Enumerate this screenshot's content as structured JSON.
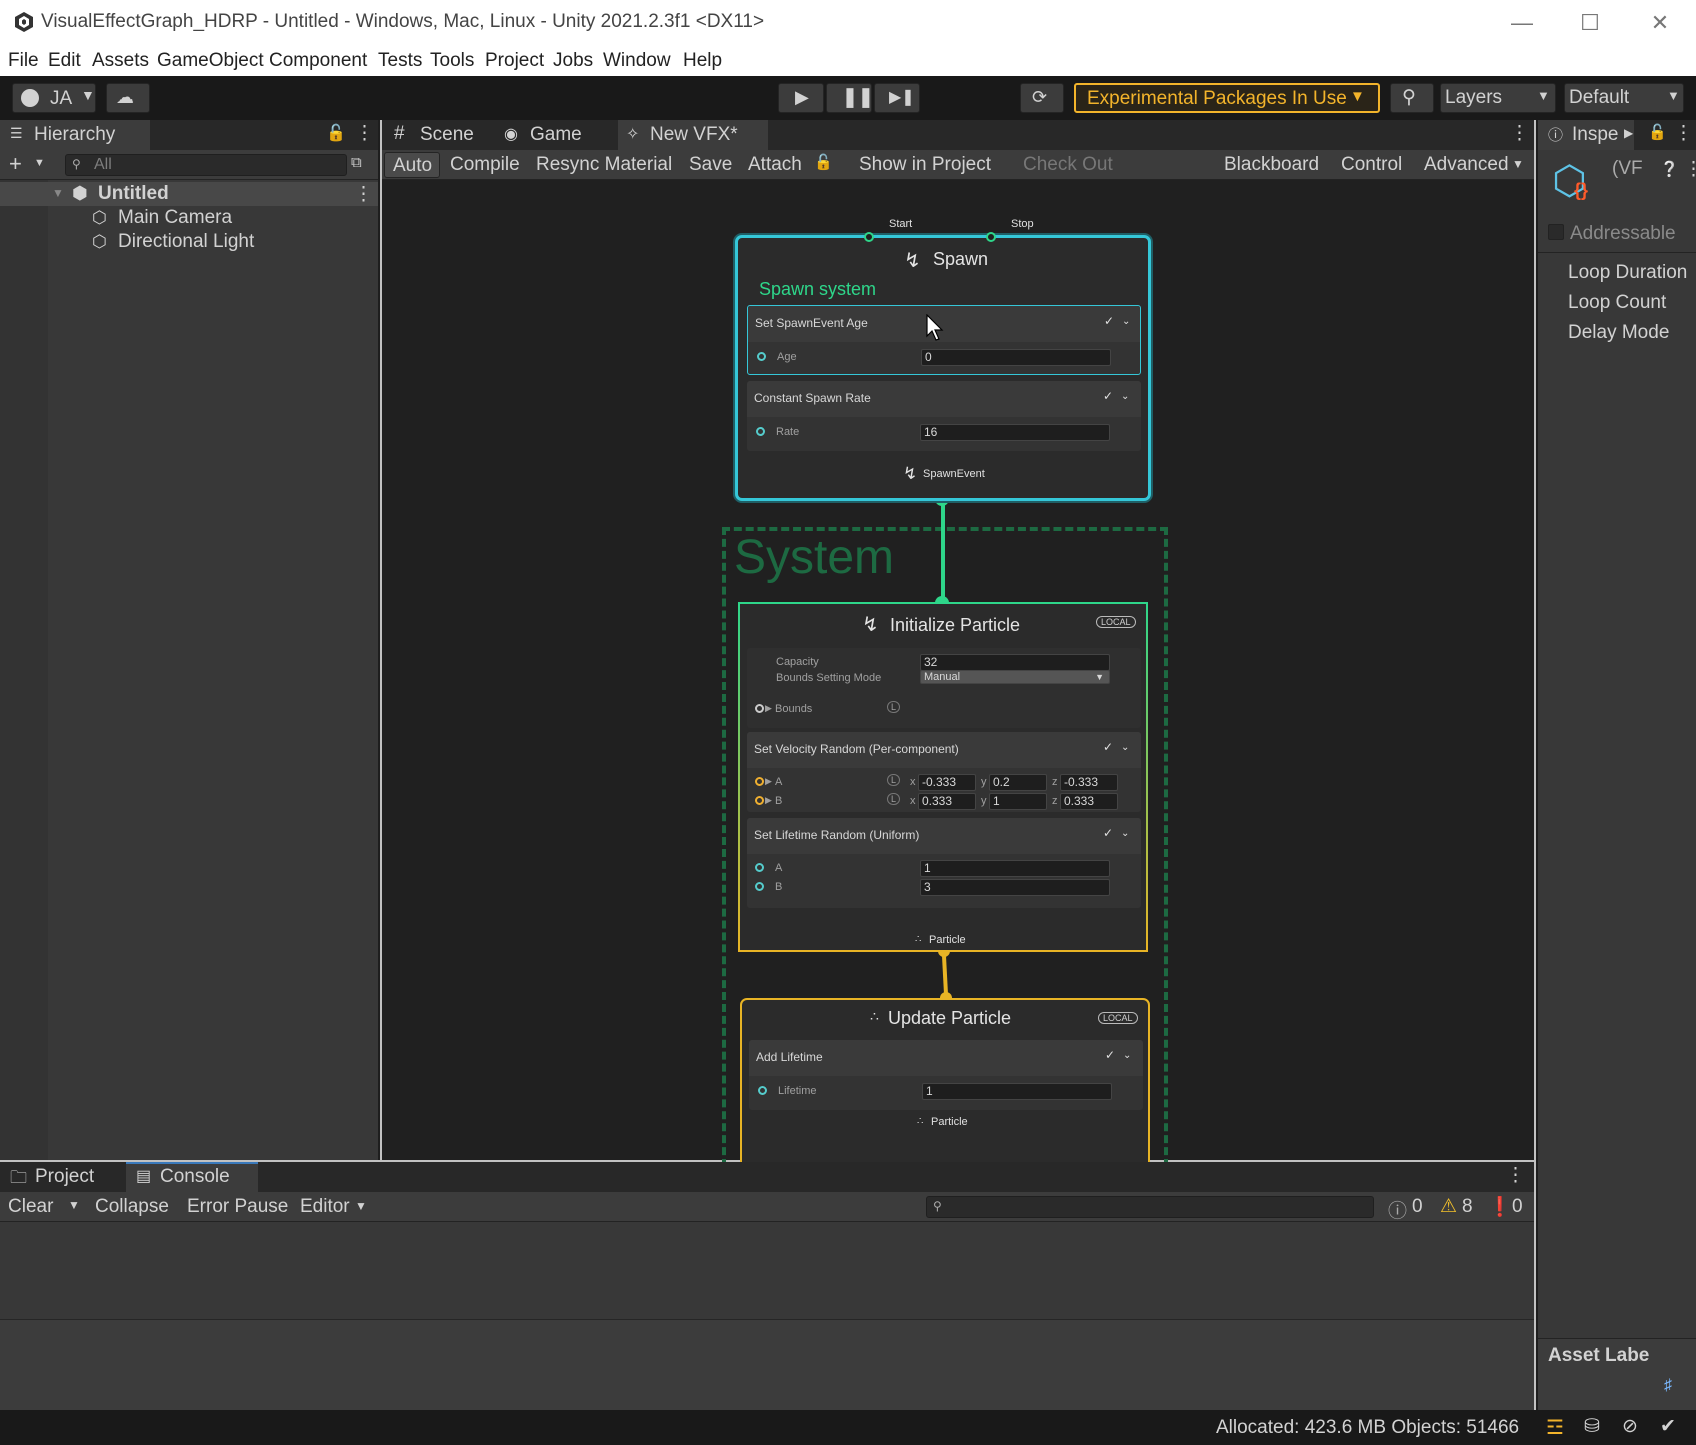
{
  "window": {
    "title": "VisualEffectGraph_HDRP - Untitled - Windows, Mac, Linux - Unity 2021.2.3f1 <DX11>"
  },
  "menu": [
    "File",
    "Edit",
    "Assets",
    "GameObject",
    "Component",
    "Tests",
    "Tools",
    "Project",
    "Jobs",
    "Window",
    "Help"
  ],
  "toolbar": {
    "account": "JA",
    "experimental": "Experimental Packages In Use",
    "layers": "Layers",
    "layout": "Default"
  },
  "hierarchy": {
    "tab": "Hierarchy",
    "search_placeholder": "All",
    "scene": "Untitled",
    "items": [
      "Main Camera",
      "Directional Light"
    ]
  },
  "vfx_tabs": [
    "Scene",
    "Game",
    "New VFX*"
  ],
  "vfx_toolbar": {
    "auto": "Auto",
    "compile": "Compile",
    "resync": "Resync Material",
    "save": "Save",
    "attach": "Attach",
    "show_in_project": "Show in Project",
    "check_out": "Check Out",
    "blackboard": "Blackboard",
    "control": "Control",
    "advanced": "Advanced"
  },
  "spawn": {
    "title": "Spawn",
    "start": "Start",
    "stop": "Stop",
    "subtitle": "Spawn system",
    "block1_title": "Set SpawnEvent Age",
    "block1_label": "Age",
    "block1_value": "0",
    "block2_title": "Constant Spawn Rate",
    "block2_label": "Rate",
    "block2_value": "16",
    "output": "SpawnEvent"
  },
  "system": {
    "label": "System"
  },
  "init": {
    "title": "Initialize Particle",
    "local": "LOCAL",
    "capacity_label": "Capacity",
    "capacity_value": "32",
    "bounds_mode_label": "Bounds Setting Mode",
    "bounds_mode_value": "Manual",
    "bounds_label": "Bounds",
    "vel_title": "Set Velocity Random (Per-component)",
    "vel_a_label": "A",
    "vel_a": {
      "x": "-0.333",
      "y": "0.2",
      "z": "-0.333"
    },
    "vel_b_label": "B",
    "vel_b": {
      "x": "0.333",
      "y": "1",
      "z": "0.333"
    },
    "life_title": "Set Lifetime Random (Uniform)",
    "life_a_label": "A",
    "life_a": "1",
    "life_b_label": "B",
    "life_b": "3",
    "output": "Particle"
  },
  "update": {
    "title": "Update Particle",
    "local": "LOCAL",
    "block_title": "Add Lifetime",
    "block_label": "Lifetime",
    "block_value": "1",
    "output": "Particle"
  },
  "inspector": {
    "tab": "Inspe",
    "asset_name": "(VF",
    "addressable": "Addressable",
    "items": [
      "Loop Duration",
      "Loop Count",
      "Delay Mode"
    ],
    "asset_labels": "Asset Labe"
  },
  "console": {
    "tabs": [
      "Project",
      "Console"
    ],
    "clear": "Clear",
    "collapse": "Collapse",
    "error_pause": "Error Pause",
    "editor": "Editor",
    "info_count": "0",
    "warn_count": "8",
    "error_count": "0"
  },
  "status": {
    "text": "Allocated: 423.6 MB Objects: 51466"
  },
  "colors": {
    "spawn_border": "#35c7d8",
    "init_border": "#2ed68a",
    "particle_border": "#e8b425",
    "system_dash": "#1d6a42",
    "experimental": "#f3b42b"
  }
}
